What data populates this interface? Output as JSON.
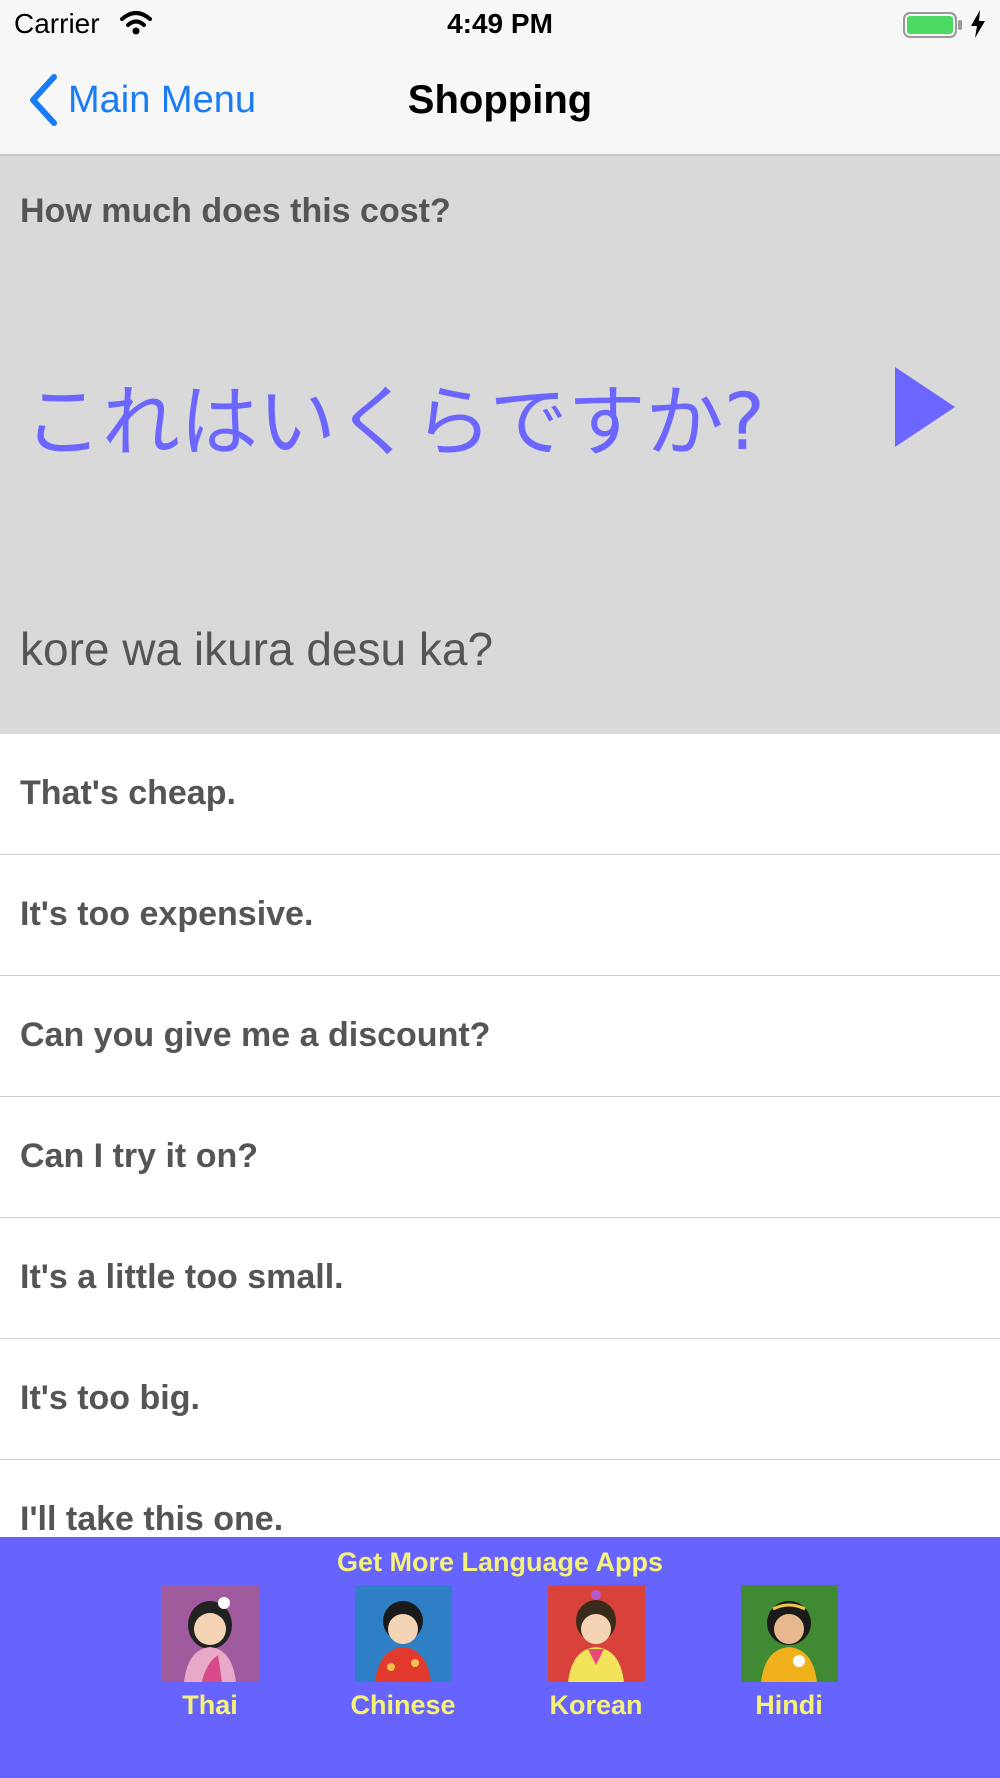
{
  "status_bar": {
    "carrier": "Carrier",
    "time": "4:49 PM",
    "icons": [
      "wifi-icon",
      "battery-icon",
      "charging-icon"
    ],
    "battery_color": "#4cd964"
  },
  "nav": {
    "back_label": "Main Menu",
    "title": "Shopping",
    "accent_color": "#1a7cf5"
  },
  "phrase": {
    "english": "How much does this cost?",
    "native": "これはいくらですか?",
    "romanization": "kore wa ikura desu ka?",
    "play_icon": "play-icon",
    "native_color": "#6b66ff"
  },
  "phrase_list": [
    "That's cheap.",
    "It's too expensive.",
    "Can you give me a discount?",
    "Can I try it on?",
    "It's a little too small.",
    "It's too big.",
    "I'll take this one."
  ],
  "promo": {
    "title": "Get More Language Apps",
    "background": "#6763ff",
    "text_color": "#f6f277",
    "apps": [
      {
        "label": "Thai",
        "thumb_bg": "#a05a9e"
      },
      {
        "label": "Chinese",
        "thumb_bg": "#2f7fc7"
      },
      {
        "label": "Korean",
        "thumb_bg": "#d9423a"
      },
      {
        "label": "Hindi",
        "thumb_bg": "#3f8a33"
      }
    ]
  }
}
